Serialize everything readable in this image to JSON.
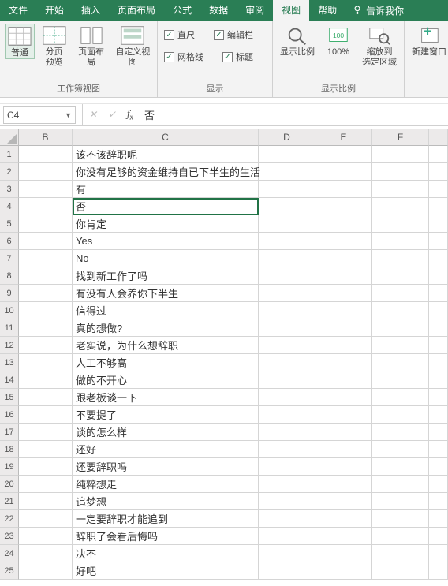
{
  "menu": {
    "file": "文件",
    "home": "开始",
    "insert": "插入",
    "layout": "页面布局",
    "formulas": "公式",
    "data": "数据",
    "review": "审阅",
    "view": "视图",
    "help": "帮助",
    "tellme": "告诉我你"
  },
  "ribbon": {
    "views": {
      "normal": "普通",
      "pagebreak": "分页\n预览",
      "pagelayout": "页面布局",
      "custom": "自定义视图",
      "group": "工作簿视图"
    },
    "show": {
      "ruler": "直尺",
      "formulabar": "编辑栏",
      "gridlines": "网格线",
      "headings": "标题",
      "group": "显示"
    },
    "zoom": {
      "zoom": "显示比例",
      "hundred": "100%",
      "tosel": "缩放到\n选定区域",
      "group": "显示比例"
    },
    "window": {
      "new": "新建窗口"
    }
  },
  "namebox": "C4",
  "formula_value": "否",
  "columns": [
    "B",
    "C",
    "D",
    "E",
    "F"
  ],
  "rows": [
    {
      "n": 1,
      "c": "该不该辞职呢"
    },
    {
      "n": 2,
      "c": "你没有足够的资金维持自已下半生的生活"
    },
    {
      "n": 3,
      "c": "有"
    },
    {
      "n": 4,
      "c": "否"
    },
    {
      "n": 5,
      "c": "你肯定"
    },
    {
      "n": 6,
      "c": "Yes"
    },
    {
      "n": 7,
      "c": "No"
    },
    {
      "n": 8,
      "c": "找到新工作了吗"
    },
    {
      "n": 9,
      "c": "有没有人会养你下半生"
    },
    {
      "n": 10,
      "c": "信得过"
    },
    {
      "n": 11,
      "c": "真的想做?"
    },
    {
      "n": 12,
      "c": "老实说，为什么想辞职"
    },
    {
      "n": 13,
      "c": "人工不够高"
    },
    {
      "n": 14,
      "c": "做的不开心"
    },
    {
      "n": 15,
      "c": "跟老板谈一下"
    },
    {
      "n": 16,
      "c": "不要提了"
    },
    {
      "n": 17,
      "c": "谈的怎么样"
    },
    {
      "n": 18,
      "c": "还好"
    },
    {
      "n": 19,
      "c": "还要辞职吗"
    },
    {
      "n": 20,
      "c": "纯粹想走"
    },
    {
      "n": 21,
      "c": "追梦想"
    },
    {
      "n": 22,
      "c": "一定要辞职才能追到"
    },
    {
      "n": 23,
      "c": "辞职了会看后悔吗"
    },
    {
      "n": 24,
      "c": "决不"
    },
    {
      "n": 25,
      "c": "好吧"
    }
  ],
  "active_cell": "C4"
}
